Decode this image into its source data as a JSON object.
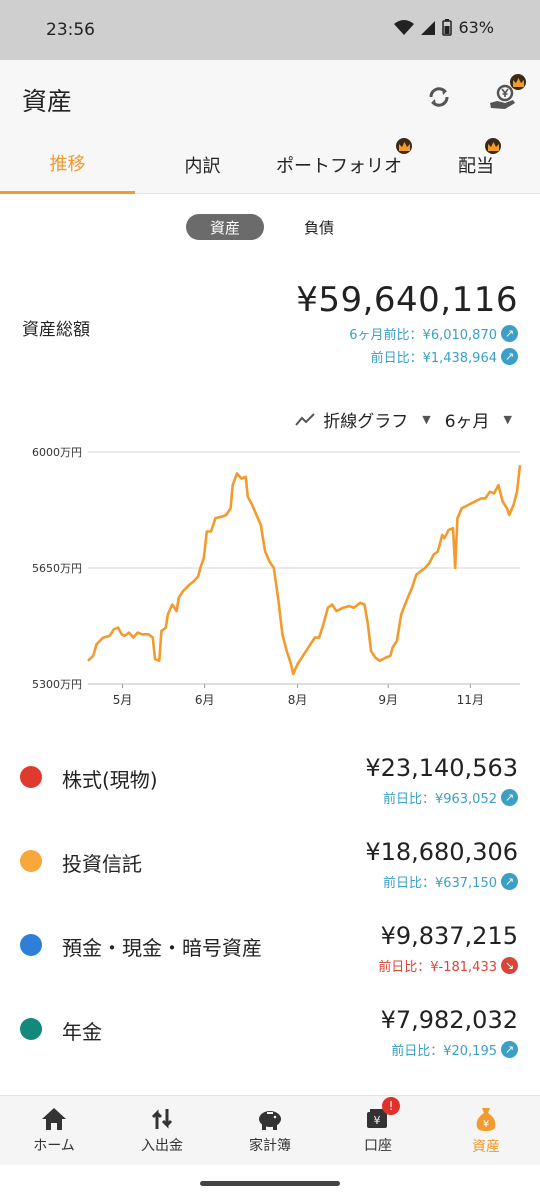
{
  "status": {
    "time": "23:56",
    "battery": "63%"
  },
  "header": {
    "title": "資産",
    "sync_icon": "sync-icon",
    "yen_hand_icon": "yen-hand-icon"
  },
  "tabs": [
    {
      "label": "推移",
      "active": true,
      "premium": false
    },
    {
      "label": "内訳",
      "active": false,
      "premium": false
    },
    {
      "label": "ポートフォリオ",
      "active": false,
      "premium": true
    },
    {
      "label": "配当",
      "active": false,
      "premium": true
    }
  ],
  "toggle": {
    "assets": "資産",
    "liabilities": "負債",
    "selected": "資産"
  },
  "summary": {
    "label": "資産総額",
    "total": "¥59,640,116",
    "six_month": "6ヶ月前比：¥6,010,870",
    "previous_day": "前日比：¥1,438,964"
  },
  "chart_controls": {
    "chart_type": "折線グラフ",
    "period": "6ヶ月"
  },
  "chart_data": {
    "type": "line",
    "ylim": [
      5300,
      6000
    ],
    "yticks": [
      {
        "value": 6000,
        "label": "6000万円"
      },
      {
        "value": 5650,
        "label": "5650万円"
      },
      {
        "value": 5300,
        "label": "5300万円"
      }
    ],
    "xticks": [
      {
        "x": 0.08,
        "label": "5月"
      },
      {
        "x": 0.27,
        "label": "6月"
      },
      {
        "x": 0.485,
        "label": "8月"
      },
      {
        "x": 0.695,
        "label": "9月"
      },
      {
        "x": 0.885,
        "label": "11月"
      }
    ],
    "series": [
      {
        "color": "#f39a2d",
        "points": [
          [
            0.0,
            5370
          ],
          [
            0.012,
            5385
          ],
          [
            0.02,
            5420
          ],
          [
            0.035,
            5440
          ],
          [
            0.05,
            5445
          ],
          [
            0.06,
            5465
          ],
          [
            0.07,
            5470
          ],
          [
            0.078,
            5450
          ],
          [
            0.085,
            5445
          ],
          [
            0.095,
            5455
          ],
          [
            0.105,
            5440
          ],
          [
            0.115,
            5455
          ],
          [
            0.125,
            5450
          ],
          [
            0.14,
            5450
          ],
          [
            0.15,
            5440
          ],
          [
            0.155,
            5375
          ],
          [
            0.165,
            5370
          ],
          [
            0.17,
            5460
          ],
          [
            0.18,
            5470
          ],
          [
            0.185,
            5510
          ],
          [
            0.195,
            5540
          ],
          [
            0.205,
            5520
          ],
          [
            0.21,
            5560
          ],
          [
            0.22,
            5580
          ],
          [
            0.235,
            5600
          ],
          [
            0.245,
            5610
          ],
          [
            0.255,
            5625
          ],
          [
            0.26,
            5650
          ],
          [
            0.268,
            5680
          ],
          [
            0.275,
            5760
          ],
          [
            0.285,
            5760
          ],
          [
            0.295,
            5800
          ],
          [
            0.31,
            5805
          ],
          [
            0.32,
            5810
          ],
          [
            0.33,
            5830
          ],
          [
            0.335,
            5900
          ],
          [
            0.345,
            5935
          ],
          [
            0.355,
            5920
          ],
          [
            0.365,
            5925
          ],
          [
            0.37,
            5865
          ],
          [
            0.38,
            5840
          ],
          [
            0.39,
            5810
          ],
          [
            0.4,
            5780
          ],
          [
            0.41,
            5700
          ],
          [
            0.42,
            5670
          ],
          [
            0.43,
            5650
          ],
          [
            0.44,
            5560
          ],
          [
            0.45,
            5450
          ],
          [
            0.46,
            5400
          ],
          [
            0.47,
            5360
          ],
          [
            0.475,
            5330
          ],
          [
            0.485,
            5360
          ],
          [
            0.5,
            5390
          ],
          [
            0.515,
            5420
          ],
          [
            0.525,
            5440
          ],
          [
            0.535,
            5440
          ],
          [
            0.545,
            5480
          ],
          [
            0.555,
            5530
          ],
          [
            0.565,
            5540
          ],
          [
            0.575,
            5520
          ],
          [
            0.59,
            5530
          ],
          [
            0.605,
            5535
          ],
          [
            0.615,
            5530
          ],
          [
            0.63,
            5545
          ],
          [
            0.64,
            5540
          ],
          [
            0.648,
            5480
          ],
          [
            0.655,
            5400
          ],
          [
            0.665,
            5380
          ],
          [
            0.675,
            5370
          ],
          [
            0.69,
            5380
          ],
          [
            0.7,
            5385
          ],
          [
            0.705,
            5410
          ],
          [
            0.715,
            5430
          ],
          [
            0.725,
            5510
          ],
          [
            0.74,
            5560
          ],
          [
            0.75,
            5590
          ],
          [
            0.76,
            5630
          ],
          [
            0.77,
            5640
          ],
          [
            0.78,
            5650
          ],
          [
            0.79,
            5665
          ],
          [
            0.8,
            5690
          ],
          [
            0.81,
            5700
          ],
          [
            0.82,
            5750
          ],
          [
            0.825,
            5740
          ],
          [
            0.835,
            5765
          ],
          [
            0.845,
            5770
          ],
          [
            0.85,
            5650
          ],
          [
            0.855,
            5800
          ],
          [
            0.865,
            5830
          ],
          [
            0.88,
            5840
          ],
          [
            0.895,
            5850
          ],
          [
            0.91,
            5860
          ],
          [
            0.92,
            5860
          ],
          [
            0.93,
            5880
          ],
          [
            0.94,
            5875
          ],
          [
            0.95,
            5900
          ],
          [
            0.96,
            5850
          ],
          [
            0.97,
            5830
          ],
          [
            0.975,
            5810
          ],
          [
            0.985,
            5840
          ],
          [
            0.993,
            5880
          ],
          [
            1.0,
            5960
          ]
        ]
      }
    ]
  },
  "assets": [
    {
      "name": "株式(現物)",
      "color": "#e03a2f",
      "value": "¥23,140,563",
      "cmp": "前日比：¥963,052",
      "trend": "up"
    },
    {
      "name": "投資信託",
      "color": "#f8a83a",
      "value": "¥18,680,306",
      "cmp": "前日比：¥637,150",
      "trend": "up"
    },
    {
      "name": "預金・現金・暗号資産",
      "color": "#2f7fd8",
      "value": "¥9,837,215",
      "cmp": "前日比：¥-181,433",
      "trend": "down"
    },
    {
      "name": "年金",
      "color": "#12897a",
      "value": "¥7,982,032",
      "cmp": "前日比：¥20,195",
      "trend": "up"
    }
  ],
  "bottom_nav": [
    {
      "label": "ホーム",
      "icon": "home-icon",
      "active": false
    },
    {
      "label": "入出金",
      "icon": "transfer-icon",
      "active": false
    },
    {
      "label": "家計簿",
      "icon": "piggy-bank-icon",
      "active": false
    },
    {
      "label": "口座",
      "icon": "account-icon",
      "active": false,
      "badge": "!"
    },
    {
      "label": "資産",
      "icon": "money-bag-icon",
      "active": true
    }
  ]
}
